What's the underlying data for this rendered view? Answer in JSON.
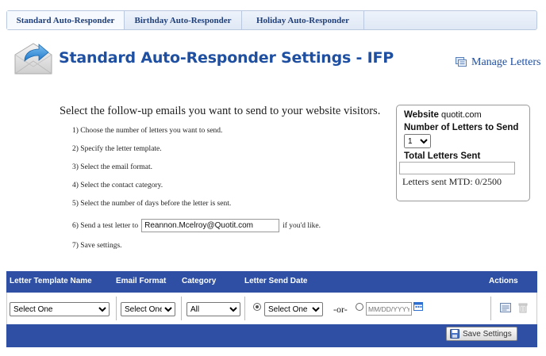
{
  "tabs": [
    {
      "label": "Standard Auto-Responder"
    },
    {
      "label": "Birthday Auto-Responder"
    },
    {
      "label": "Holiday Auto-Responder"
    }
  ],
  "header": {
    "title": "Standard Auto-Responder Settings - IFP",
    "manage_letters": "Manage Letters"
  },
  "instructions": {
    "intro": "Select the follow-up emails you want to send to your website visitors.",
    "step1": "1) Choose the number of letters you want to send.",
    "step2": "2) Specify the letter template.",
    "step3": "3) Select the email format.",
    "step4": "4) Select the contact category.",
    "step5": "5) Select the number of days before the letter is sent.",
    "step6_prefix": "6) Send a test letter to",
    "step6_email": "Reannon.Mcelroy@Quotit.com",
    "step6_suffix": "if you'd like.",
    "step7": "7) Save settings."
  },
  "info_box": {
    "website_label": "Website",
    "website_value": "quotit.com",
    "num_letters_label": "Number of Letters to Send",
    "num_letters_value": "1",
    "total_sent_label": "Total Letters Sent",
    "total_sent_value": "",
    "mtd_text": "Letters sent MTD: 0/2500"
  },
  "table": {
    "headers": {
      "template": "Letter Template Name",
      "format": "Email Format",
      "category": "Category",
      "send_date": "Letter Send Date",
      "actions": "Actions"
    },
    "row": {
      "template_value": "Select One",
      "format_value": "Select One",
      "category_value": "All",
      "days_value": "Select One",
      "or_label": "-or-",
      "date_placeholder": "MM/DD/YYYY"
    },
    "save_label": "Save Settings"
  },
  "colors": {
    "accent": "#2e4fa3",
    "title": "#1f4fa0"
  }
}
